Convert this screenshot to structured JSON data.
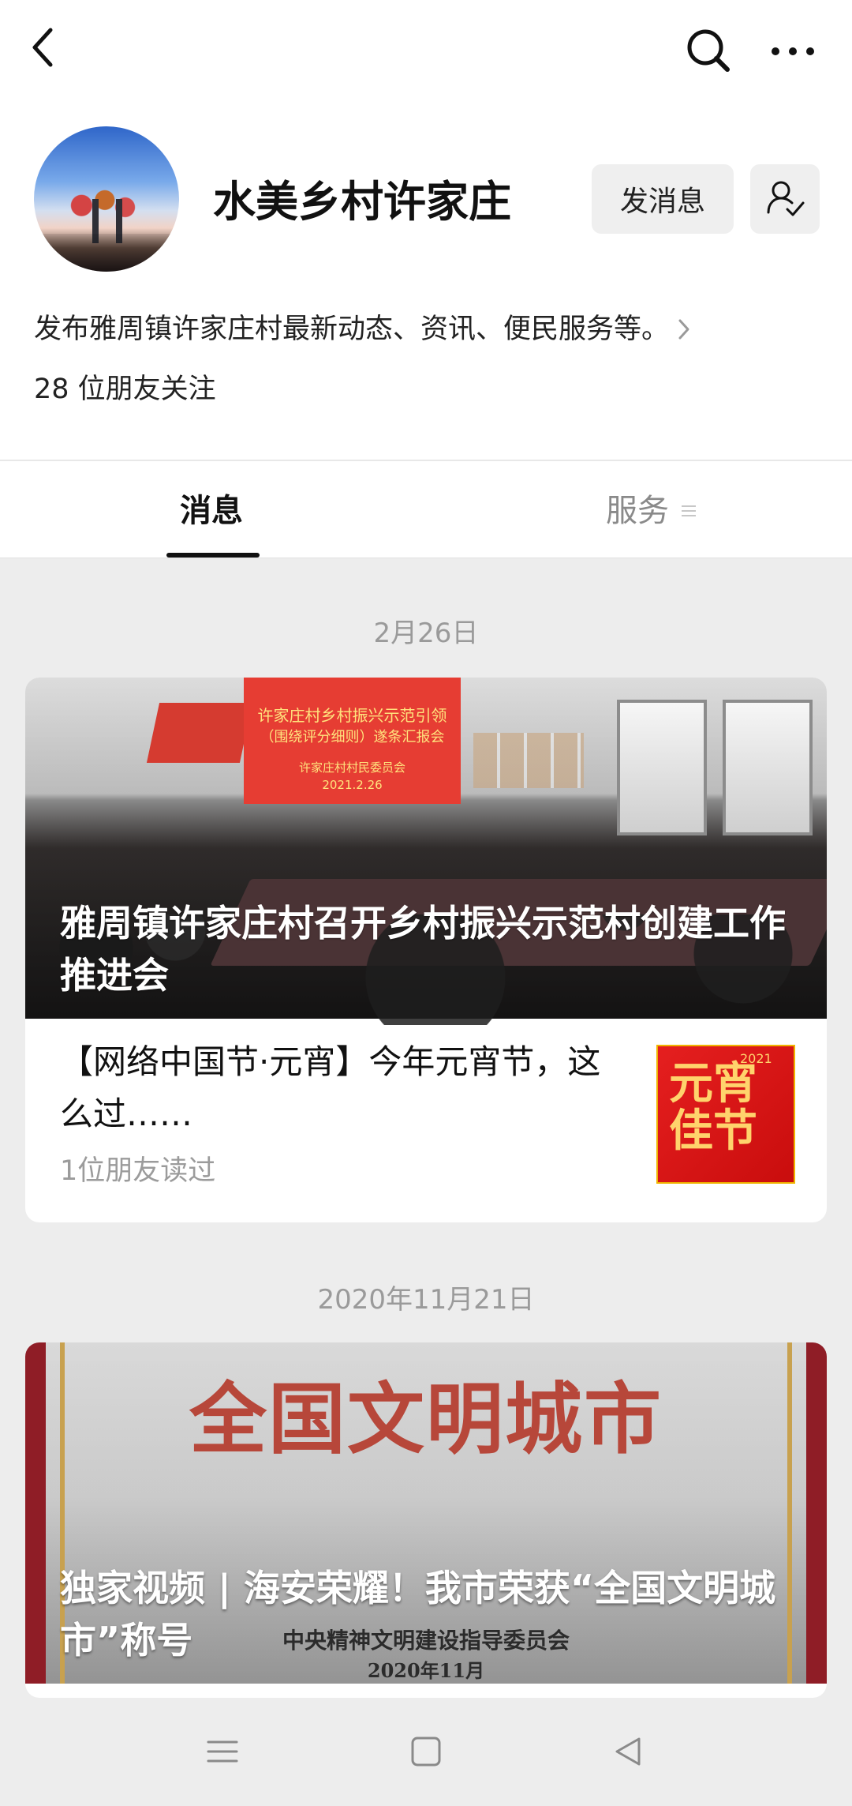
{
  "colors": {
    "background": "#ededed",
    "surface": "#ffffff",
    "primary_text": "#111111",
    "secondary_text": "#9a9a9a"
  },
  "top_bar": {
    "icons": [
      "back-icon",
      "search-icon",
      "more-icon"
    ]
  },
  "profile": {
    "name": "水美乡村许家庄",
    "send_message_label": "发消息",
    "description": "发布雅周镇许家庄村最新动态、资讯、便民服务等。",
    "followers_text": "28 位朋友关注"
  },
  "tabs": [
    {
      "label": "消息"
    },
    {
      "label": "服务"
    }
  ],
  "feed": [
    {
      "date": "2月26日",
      "hero": {
        "title": "雅周镇许家庄村召开乡村振兴示范村创建工作推进会",
        "screen_lines": [
          "许家庄村乡村振兴示范引领",
          "（围绕评分细则）遂条汇报会",
          "许家庄村村民委员会",
          "2021.2.26"
        ]
      },
      "item": {
        "title": "【网络中国节·元宵】今年元宵节，这么过……",
        "meta": "1位朋友读过",
        "thumb_text": "元宵佳节",
        "thumb_small": "2021"
      }
    },
    {
      "date": "2020年11月21日",
      "hero": {
        "sign": "全国文明城市",
        "sign_sub": "中央精神文明建设指导委员会",
        "sign_date": "2020年11月",
        "title": "独家视频 | 海安荣耀！我市荣获“全国文明城市”称号"
      }
    }
  ]
}
